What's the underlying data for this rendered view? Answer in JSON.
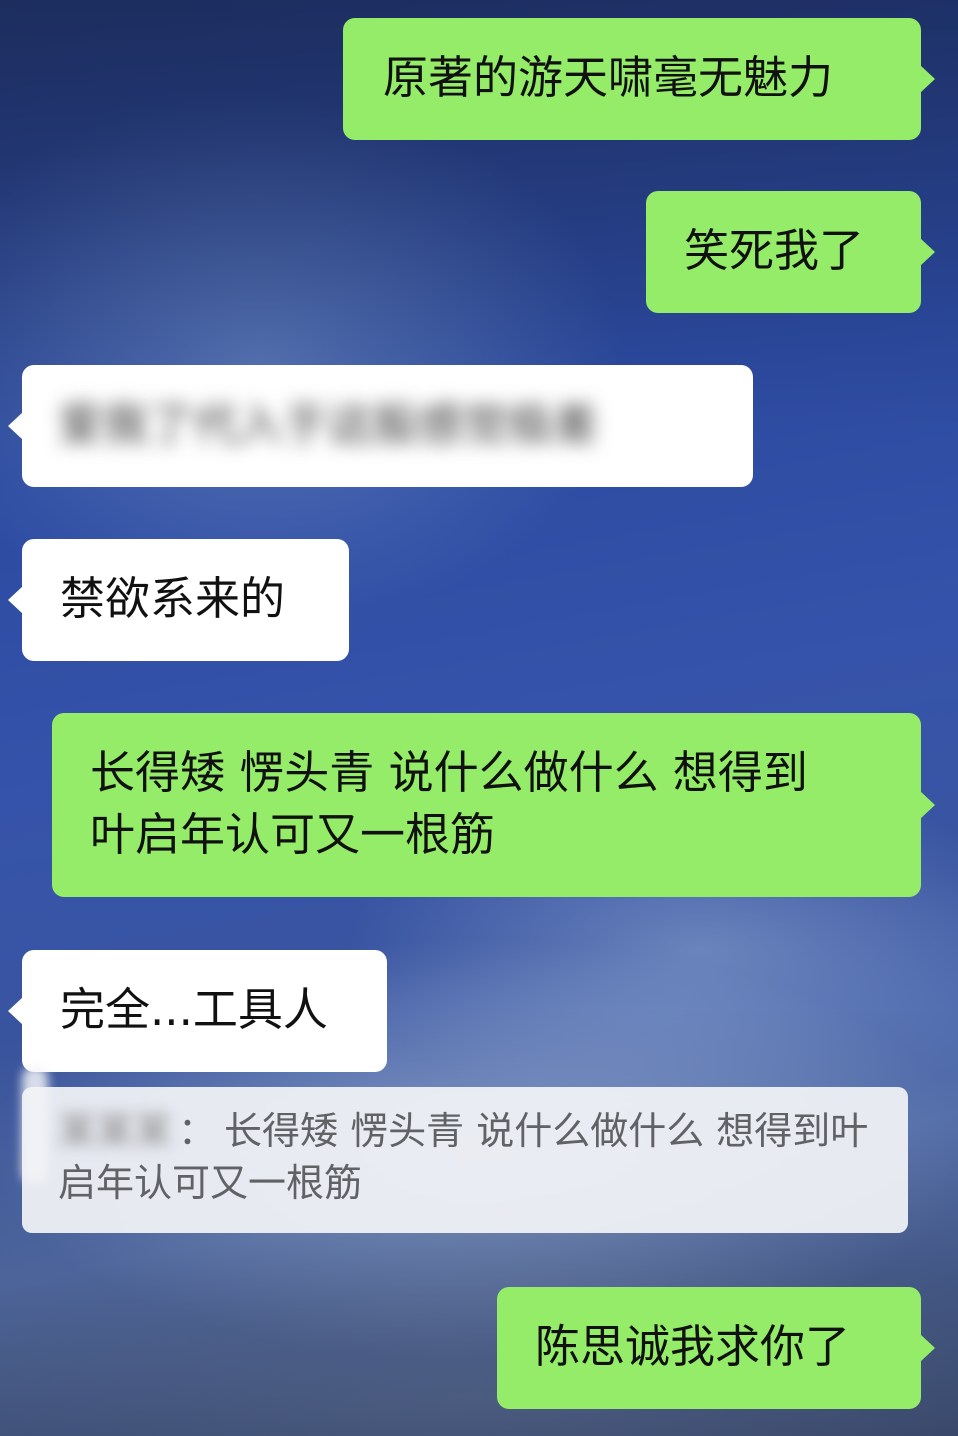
{
  "background": {
    "kind": "blurred photo wallpaper",
    "colors": {
      "main": "#2f4ea6",
      "light": "#b8c8e6",
      "dark": "#1e2c5a"
    }
  },
  "colors": {
    "own_bubble": "#95ec69",
    "other_bubble": "#ffffff",
    "quote_bg": "#f2f3f6",
    "quote_text": "#606266"
  },
  "messages": [
    {
      "side": "right",
      "text": "原著的游天啸毫无魅力"
    },
    {
      "side": "right",
      "text": "笑死我了"
    },
    {
      "side": "left",
      "text": "爱我了代入于这股感觉极差",
      "blurred": true
    },
    {
      "side": "left",
      "text": "禁欲系来的"
    },
    {
      "side": "right",
      "line1": "长得矮 愣头青 说什么做什么 想得到",
      "line2": "叶启年认可又一根筋"
    },
    {
      "side": "left",
      "text": "完全...工具人"
    },
    {
      "side": "right",
      "text": "陈思诚我求你了"
    }
  ],
  "quote": {
    "sender": "某某某",
    "separator": "：",
    "line1_rest": "长得矮 愣头青 说什么做什么 想得到叶",
    "line2": "启年认可又一根筋"
  }
}
